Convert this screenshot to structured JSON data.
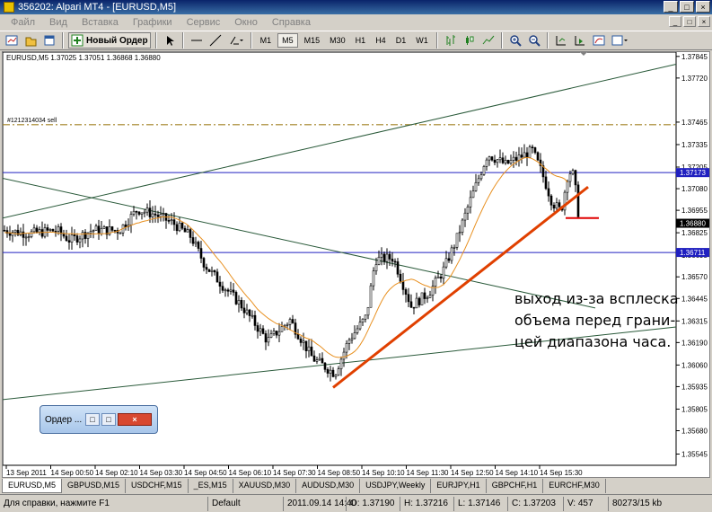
{
  "window": {
    "title": "356202: Alpari MT4 - [EURUSD,M5]",
    "buttons": [
      "_",
      "□",
      "×"
    ]
  },
  "menu": [
    "Файл",
    "Вид",
    "Вставка",
    "Графики",
    "Сервис",
    "Окно",
    "Справка"
  ],
  "toolbar": {
    "new_order_label": "Новый Ордер",
    "timeframes": [
      "M1",
      "M5",
      "M15",
      "M30",
      "H1",
      "H4",
      "D1",
      "W1"
    ],
    "active_timeframe": "M5"
  },
  "chart_header": "EURUSD,M5  1.37025 1.37051 1.36868 1.36880",
  "order_label": "#1212314034 sell",
  "annotation_lines": [
    "выход из-за всплеска",
    "объема перед  грани-",
    "цей диапазона часа."
  ],
  "chart_data": {
    "type": "candlestick",
    "symbol": "EURUSD",
    "timeframe": "M5",
    "ylim": [
      1.3548,
      1.3787
    ],
    "y_ticks": [
      1.37845,
      1.3772,
      1.37465,
      1.37335,
      1.37205,
      1.3708,
      1.36955,
      1.36825,
      1.36695,
      1.3657,
      1.36445,
      1.36315,
      1.3619,
      1.3606,
      1.35935,
      1.35805,
      1.3568,
      1.35545
    ],
    "x_ticks": [
      "13 Sep 2011",
      "14 Sep 00:50",
      "14 Sep 02:10",
      "14 Sep 03:30",
      "14 Sep 04:50",
      "14 Sep 06:10",
      "14 Sep 07:30",
      "14 Sep 08:50",
      "14 Sep 10:10",
      "14 Sep 11:30",
      "14 Sep 12:50",
      "14 Sep 14:10",
      "14 Sep 15:30"
    ],
    "current_price": 1.3688,
    "horizontal_levels": [
      {
        "price": 1.37173,
        "color": "#2020c0",
        "label": "1.37173"
      },
      {
        "price": 1.36711,
        "color": "#2020c0",
        "label": "1.36711"
      },
      {
        "price": 1.3745,
        "color": "#a08020",
        "style": "dash-dot",
        "label": "#1212314034 sell"
      }
    ],
    "colors": {
      "candles": "#000000",
      "ma": "#e89020",
      "trendline": "#e04000",
      "channel": "#2a5a3a",
      "exit_marker": "#e00000"
    }
  },
  "tabs": [
    "EURUSD,M5",
    "GBPUSD,M15",
    "USDCHF,M15",
    "_ES,M15",
    "XAUUSD,M30",
    "AUDUSD,M30",
    "USDJPY,Weekly",
    "EURJPY,H1",
    "GBPCHF,H1",
    "EURCHF,M30"
  ],
  "active_tab": "EURUSD,M5",
  "status": {
    "help": "Для справки, нажмите F1",
    "profile": "Default",
    "datetime": "2011.09.14 14:40",
    "open": "O: 1.37190",
    "high": "H: 1.37216",
    "low": "L: 1.37146",
    "close": "C: 1.37203",
    "volume": "V: 457",
    "traffic": "80273/15 kb"
  },
  "order_window": {
    "title": "Ордер ..."
  }
}
